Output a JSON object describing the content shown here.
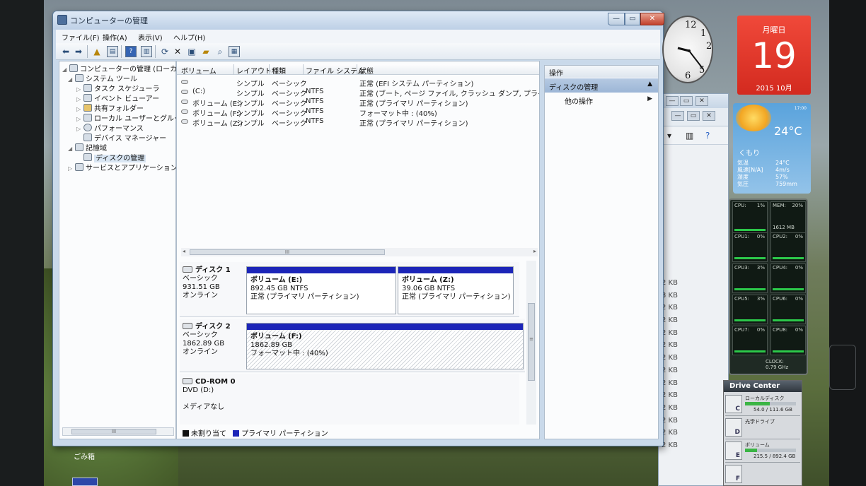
{
  "window": {
    "title": "コンピューターの管理",
    "controls": {
      "minimize": "—",
      "maximize": "▭",
      "close": "✕"
    }
  },
  "menu": [
    "ファイル(F)",
    "操作(A)",
    "表示(V)",
    "ヘルプ(H)"
  ],
  "tree": {
    "root": "コンピューターの管理 (ローカル)",
    "system_tools": "システム ツール",
    "task_scheduler": "タスク スケジューラ",
    "event_viewer": "イベント ビューアー",
    "shared_folders": "共有フォルダー",
    "local_users": "ローカル ユーザーとグループ",
    "performance": "パフォーマンス",
    "device_manager": "デバイス マネージャー",
    "storage": "記憶域",
    "disk_management": "ディスクの管理",
    "services_apps": "サービスとアプリケーション",
    "scroll_thumb": "III"
  },
  "volume_table": {
    "headers": [
      "ボリューム",
      "レイアウト",
      "種類",
      "ファイル システム",
      "状態"
    ],
    "rows": [
      {
        "volume": "",
        "layout": "シンプル",
        "type": "ベーシック",
        "fs": "",
        "status": "正常 (EFI システム パーティション)"
      },
      {
        "volume": "(C:)",
        "layout": "シンプル",
        "type": "ベーシック",
        "fs": "NTFS",
        "status": "正常 (ブート, ページ ファイル, クラッシュ ダンプ, プライマリ パーティ"
      },
      {
        "volume": "ボリューム (E:)",
        "layout": "シンプル",
        "type": "ベーシック",
        "fs": "NTFS",
        "status": "正常 (プライマリ パーティション)"
      },
      {
        "volume": "ボリューム (F:)",
        "layout": "シンプル",
        "type": "ベーシック",
        "fs": "NTFS",
        "status": "フォーマット中 : (40%)"
      },
      {
        "volume": "ボリューム (Z:)",
        "layout": "シンプル",
        "type": "ベーシック",
        "fs": "NTFS",
        "status": "正常 (プライマリ パーティション)"
      }
    ],
    "scroll_thumb": "III"
  },
  "disks": {
    "disk1": {
      "name": "ディスク 1",
      "type": "ベーシック",
      "size": "931.51 GB",
      "state": "オンライン",
      "partitions": [
        {
          "name": "ボリューム (E:)",
          "size": "892.45 GB NTFS",
          "status": "正常 (プライマリ パーティション)"
        },
        {
          "name": "ボリューム (Z:)",
          "size": "39.06 GB NTFS",
          "status": "正常 (プライマリ パーティション)"
        }
      ]
    },
    "disk2": {
      "name": "ディスク 2",
      "type": "ベーシック",
      "size": "1862.89 GB",
      "state": "オンライン",
      "partitions": [
        {
          "name": "ボリューム (F:)",
          "size": "1862.89 GB",
          "status": "フォーマット中 : (40%)"
        }
      ]
    },
    "cdrom": {
      "name": "CD-ROM 0",
      "drive": "DVD (D:)",
      "media": "メディアなし"
    }
  },
  "legend": {
    "unallocated": "未割り当て",
    "primary": "プライマリ パーティション"
  },
  "legend_colors": {
    "unallocated": "#111111",
    "primary": "#1c25b8"
  },
  "actions": {
    "header": "操作",
    "section": "ディスクの管理",
    "more": "他の操作"
  },
  "back_window_sizes": [
    "2 KB",
    "3 KB",
    "2 KB",
    "2 KB",
    "2 KB",
    "2 KB",
    "2 KB",
    "2 KB",
    "2 KB",
    "2 KB",
    "2 KB",
    "2 KB",
    "2 KB",
    "2 KB"
  ],
  "gadgets": {
    "clock": {
      "n12": "12",
      "n1": "1",
      "n2": "2",
      "n6": "6",
      "n5": "5"
    },
    "calendar": {
      "weekday": "月曜日",
      "day": "19",
      "month": "2015 10月"
    },
    "weather": {
      "time": "17:00",
      "temperature": "24°C",
      "condition": "くもり",
      "details": [
        {
          "label": "気温",
          "value": "24°C"
        },
        {
          "label": "風速[N/A]",
          "value": "4m/s"
        },
        {
          "label": "湿度",
          "value": "57%"
        },
        {
          "label": "気圧",
          "value": "759mm"
        }
      ]
    },
    "cpu": {
      "cells": [
        {
          "label": "CPU:",
          "value": "1%"
        },
        {
          "label": "MEM:",
          "value": "20%"
        },
        {
          "label": "CPU1:",
          "value": "0%"
        },
        {
          "label": "CPU2:",
          "value": "0%"
        },
        {
          "label": "CPU3:",
          "value": "3%"
        },
        {
          "label": "CPU4:",
          "value": "0%"
        },
        {
          "label": "CPU5:",
          "value": "3%"
        },
        {
          "label": "CPU6:",
          "value": "0%"
        },
        {
          "label": "CPU7:",
          "value": "0%"
        },
        {
          "label": "CPU8:",
          "value": "0%"
        }
      ],
      "mem_used": "1612 MB",
      "clock_label": "CLOCK:",
      "clock_value": "0.79 GHz"
    },
    "drive_center": {
      "title": "Drive Center",
      "drives": [
        {
          "name": "ローカルディスク",
          "letter": "C",
          "size": "54.0 / 111.6 GB",
          "used_fraction": 0.48
        },
        {
          "name": "光学ドライブ",
          "letter": "D",
          "size": "",
          "used_fraction": 0
        },
        {
          "name": "ボリューム",
          "letter": "E",
          "size": "215.5 / 892.4 GB",
          "used_fraction": 0.24
        },
        {
          "name": "",
          "letter": "F",
          "size": "",
          "used_fraction": 0
        }
      ]
    }
  },
  "desktop": {
    "recycle_bin": "ごみ箱"
  }
}
